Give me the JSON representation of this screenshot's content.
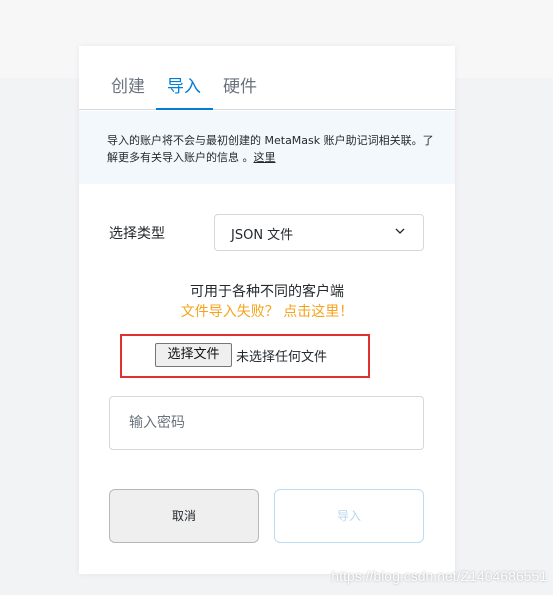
{
  "tabs": [
    {
      "label": "创建",
      "active": false
    },
    {
      "label": "导入",
      "active": true
    },
    {
      "label": "硬件",
      "active": false
    }
  ],
  "notice": {
    "text": "导入的账户将不会与最初创建的 MetaMask 账户助记词相关联。了解更多有关导入账户的信息 。",
    "link_label": "这里"
  },
  "select_type": {
    "label": "选择类型",
    "value": "JSON 文件"
  },
  "hint": {
    "description": "可用于各种不同的客户端",
    "failure_link": "文件导入失败？ 点击这里！"
  },
  "file_input": {
    "button_label": "选择文件",
    "status": "未选择任何文件"
  },
  "password": {
    "placeholder": "输入密码"
  },
  "actions": {
    "cancel_label": "取消",
    "import_label": "导入"
  },
  "watermark": "https://blog.csdn.net/Z1404686551",
  "colors": {
    "accent": "#037dd6",
    "warning_link": "#f6a31b",
    "highlight_box": "#e0322f",
    "notice_bg": "#f3f8fc"
  }
}
